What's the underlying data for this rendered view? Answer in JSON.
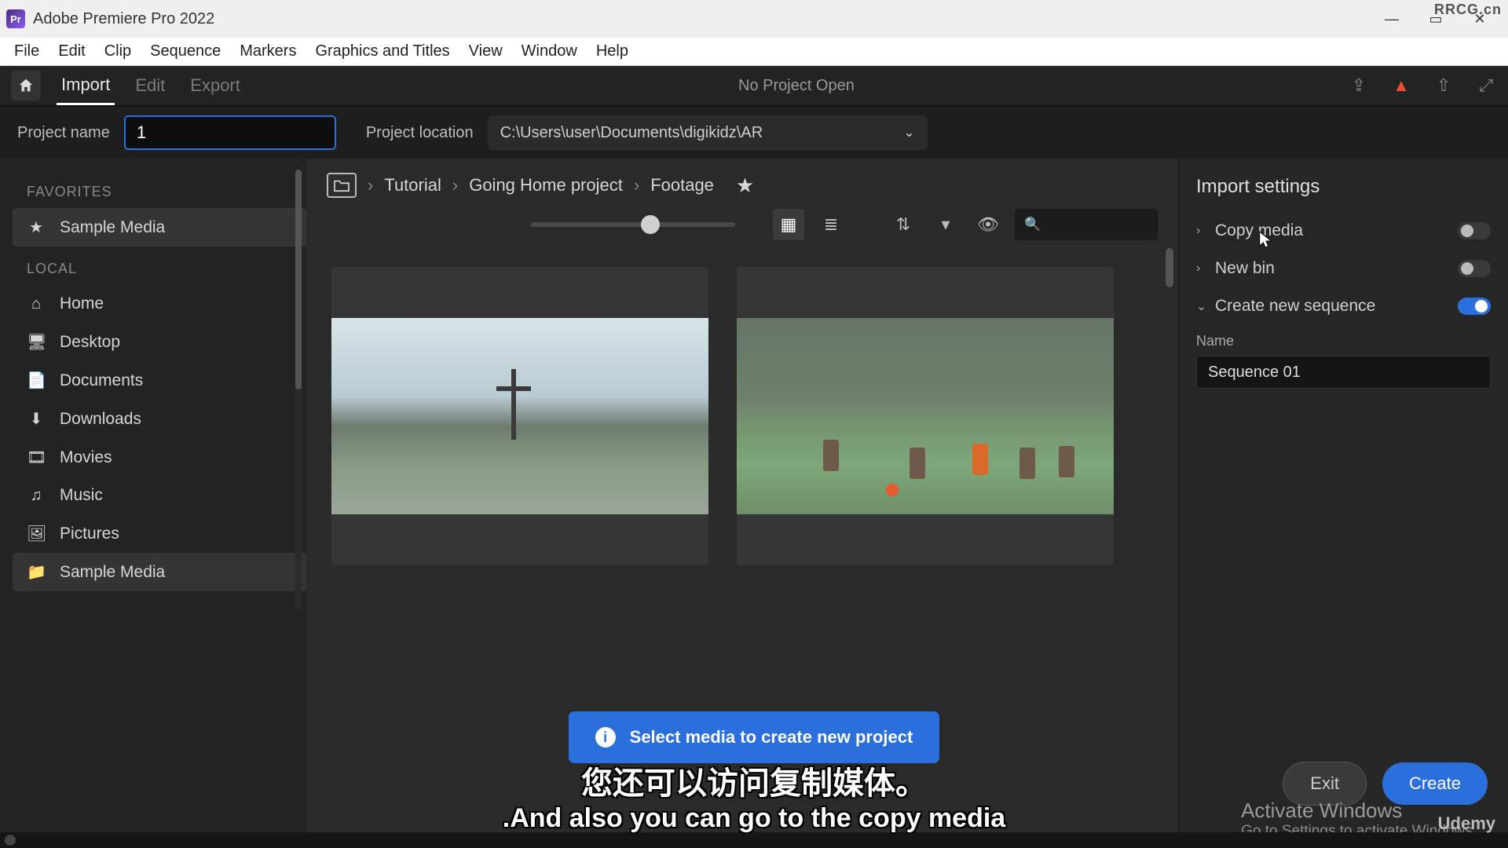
{
  "watermarks": {
    "top_right": "RRCG.cn",
    "bottom_right": "Udemy",
    "body": "RRCG"
  },
  "titlebar": {
    "app_short": "Pr",
    "title": "Adobe Premiere Pro 2022"
  },
  "menubar": [
    "File",
    "Edit",
    "Clip",
    "Sequence",
    "Markers",
    "Graphics and Titles",
    "View",
    "Window",
    "Help"
  ],
  "appbar": {
    "tabs": {
      "import": "Import",
      "edit": "Edit",
      "export": "Export"
    },
    "center": "No Project Open"
  },
  "projectbar": {
    "name_label": "Project name",
    "name_value": "1",
    "location_label": "Project location",
    "location_value": "C:\\Users\\user\\Documents\\digikidz\\AR"
  },
  "sidebar": {
    "favorites_label": "FAVORITES",
    "favorites": [
      {
        "icon": "★",
        "label": "Sample Media"
      }
    ],
    "local_label": "LOCAL",
    "local": [
      {
        "icon": "⌂",
        "label": "Home"
      },
      {
        "icon": "🖥",
        "label": "Desktop"
      },
      {
        "icon": "📄",
        "label": "Documents"
      },
      {
        "icon": "⬇",
        "label": "Downloads"
      },
      {
        "icon": "🎞",
        "label": "Movies"
      },
      {
        "icon": "♫",
        "label": "Music"
      },
      {
        "icon": "🖼",
        "label": "Pictures"
      },
      {
        "icon": "📁",
        "label": "Sample Media"
      }
    ]
  },
  "content": {
    "breadcrumb": [
      "Tutorial",
      "Going Home project",
      "Footage"
    ],
    "sep": "›"
  },
  "right": {
    "title": "Import settings",
    "copy_media": "Copy media",
    "new_bin": "New bin",
    "create_seq": "Create new sequence",
    "name_label": "Name",
    "seq_value": "Sequence 01"
  },
  "footer": {
    "banner": "Select media to create new project",
    "exit": "Exit",
    "create": "Create"
  },
  "activate": {
    "t1": "Activate Windows",
    "t2": "Go to Settings to activate Windows."
  },
  "subtitles": {
    "cn": "您还可以访问复制媒体。",
    "en": ".And also you can go to the copy media"
  }
}
